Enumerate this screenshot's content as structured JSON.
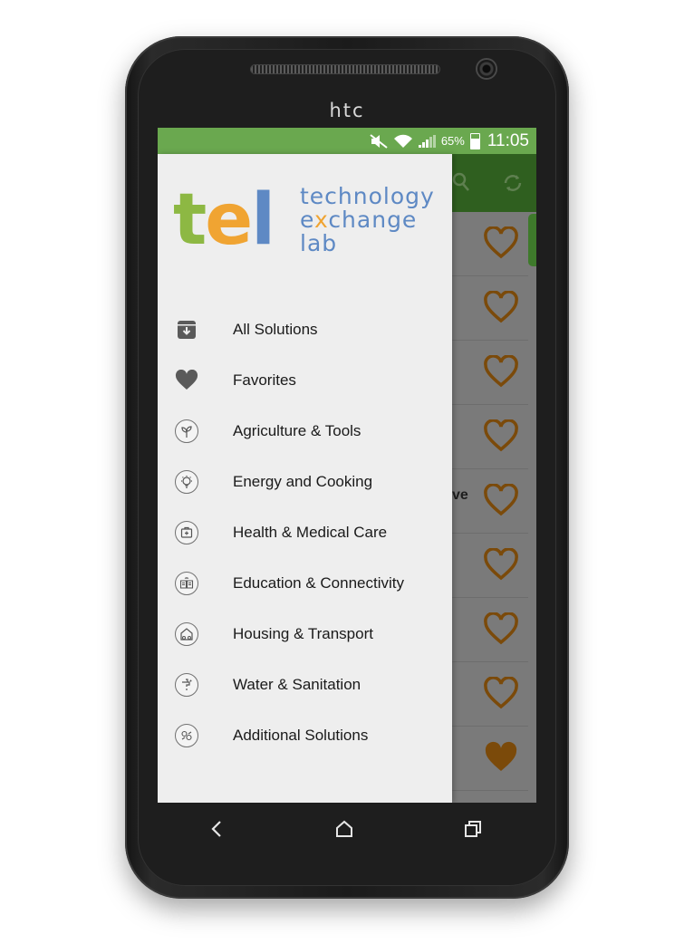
{
  "device": {
    "brand": "htc"
  },
  "statusbar": {
    "battery": "65%",
    "time": "11:05"
  },
  "logo": {
    "letters": [
      "t",
      "e",
      "l"
    ],
    "line1": "technology",
    "line2_before": "e",
    "line2_x": "x",
    "line2_after": "change",
    "line3": "lab"
  },
  "menu": {
    "items": [
      {
        "label": "All Solutions",
        "icon": "archive-icon"
      },
      {
        "label": "Favorites",
        "icon": "heart-icon"
      },
      {
        "label": "Agriculture & Tools",
        "icon": "plant-icon"
      },
      {
        "label": "Energy and Cooking",
        "icon": "bulb-icon"
      },
      {
        "label": "Health & Medical Care",
        "icon": "medical-kit-icon"
      },
      {
        "label": "Education & Connectivity",
        "icon": "book-icon"
      },
      {
        "label": "Housing & Transport",
        "icon": "house-icon"
      },
      {
        "label": "Water & Sanitation",
        "icon": "faucet-icon"
      },
      {
        "label": "Additional Solutions",
        "icon": "misc-icon"
      }
    ]
  },
  "background": {
    "partial_text": "ve"
  },
  "colors": {
    "statusbar": "#6aa84f",
    "toolbar": "#2f5f1f",
    "heart": "#7b4a0a",
    "logo_green": "#8db843",
    "logo_orange": "#f0a432",
    "logo_blue": "#5e89c4"
  }
}
